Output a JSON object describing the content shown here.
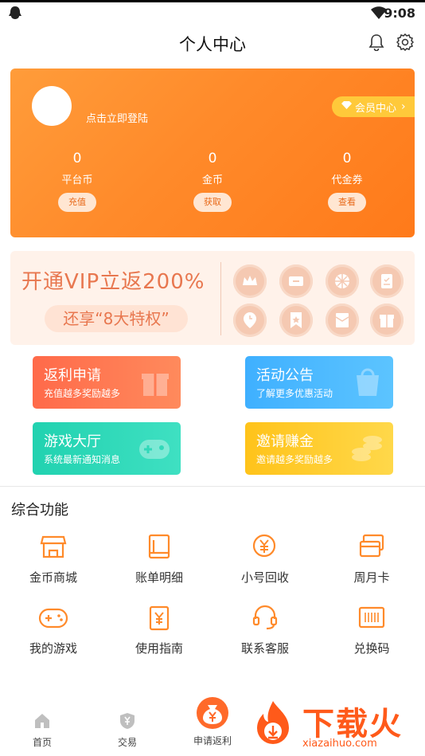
{
  "status_bar": {
    "time": "9:08",
    "icons": [
      "app-icon",
      "wifi-icon",
      "battery-icon"
    ]
  },
  "nav": {
    "title": "个人中心",
    "icons": [
      "bell-icon",
      "gear-icon"
    ]
  },
  "profile": {
    "login_prompt": "点击立即登陆",
    "vip_center": "会员中心",
    "stats": [
      {
        "value": "0",
        "label": "平台币",
        "action": "充值"
      },
      {
        "value": "0",
        "label": "金币",
        "action": "获取"
      },
      {
        "value": "0",
        "label": "代金券",
        "action": "查看"
      }
    ]
  },
  "vip_banner": {
    "headline": "开通VIP立返200%",
    "subline": "还享“8大特权”",
    "icons": [
      "crown-icon",
      "ticket-icon",
      "wheel-icon",
      "clipboard-icon",
      "clock-icon",
      "bookmark-icon",
      "envelope-icon",
      "gift-box-icon"
    ]
  },
  "promos": [
    {
      "title": "返利申请",
      "subtitle": "充值越多奖励越多",
      "color": "#ff6a4a",
      "icon": "gift-icon"
    },
    {
      "title": "活动公告",
      "subtitle": "了解更多优惠活动",
      "color": "#3fb0ff",
      "icon": "bag-icon"
    },
    {
      "title": "游戏大厅",
      "subtitle": "系统最新通知消息",
      "color": "#21d2b0",
      "icon": "gamepad-icon"
    },
    {
      "title": "邀请赚金",
      "subtitle": "邀请越多奖励越多",
      "color": "#ffc31a",
      "icon": "coins-icon"
    }
  ],
  "functions": {
    "title": "综合功能",
    "items": [
      {
        "label": "金币商城",
        "icon": "store-icon"
      },
      {
        "label": "账单明细",
        "icon": "book-icon"
      },
      {
        "label": "小号回收",
        "icon": "yen-recycle-icon"
      },
      {
        "label": "周月卡",
        "icon": "cards-icon"
      },
      {
        "label": "我的游戏",
        "icon": "gamepad-icon"
      },
      {
        "label": "使用指南",
        "icon": "guide-icon"
      },
      {
        "label": "联系客服",
        "icon": "headset-icon"
      },
      {
        "label": "兑换码",
        "icon": "barcode-icon"
      }
    ]
  },
  "tabbar": {
    "items": [
      {
        "label": "首页",
        "icon": "home-icon"
      },
      {
        "label": "交易",
        "icon": "shield-yen-icon"
      },
      {
        "label": "申请返利",
        "icon": "moneybag-icon"
      }
    ]
  },
  "watermark": {
    "title": "下载火",
    "url": "xiazaihuo.com"
  },
  "colors": {
    "accent": "#ff8a2a",
    "icon_orange": "#ff8a2a",
    "vip_text": "#e8774f"
  }
}
